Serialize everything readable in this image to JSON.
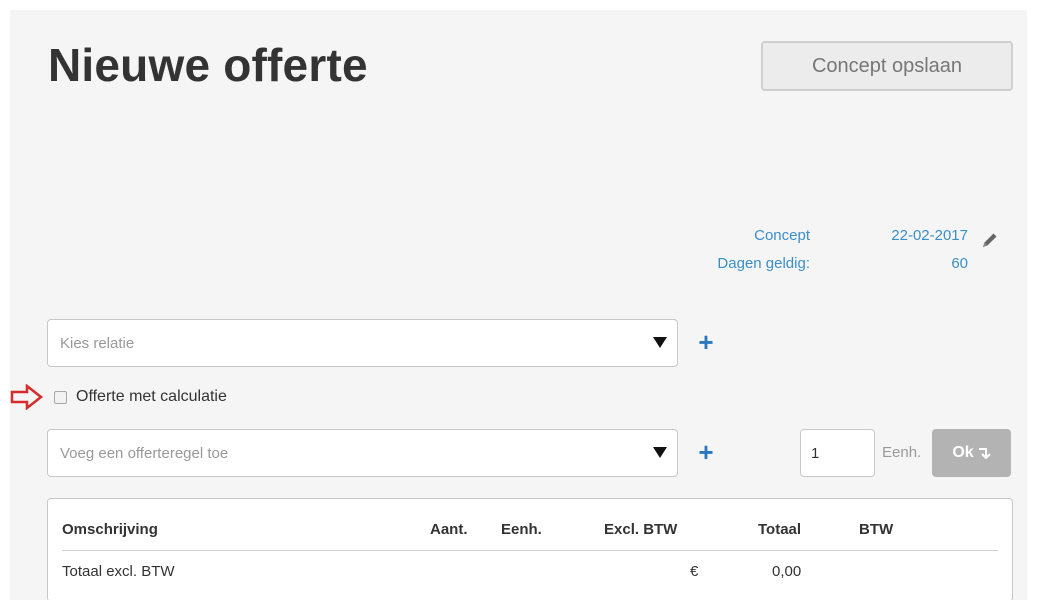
{
  "header": {
    "title": "Nieuwe offerte",
    "save_draft_label": "Concept opslaan"
  },
  "meta": {
    "status_label": "Concept",
    "date_value": "22-02-2017",
    "valid_days_label": "Dagen geldig:",
    "valid_days_value": "60",
    "edit_icon": "pencil-icon"
  },
  "relation_select": {
    "placeholder": "Kies relatie",
    "add_icon": "+"
  },
  "calculation_option": {
    "label": "Offerte met calculatie",
    "checked": false,
    "pointer_icon": "arrow-right-outline-icon",
    "pointer_color": "#d62b2b"
  },
  "line_entry": {
    "placeholder": "Voeg een offerteregel toe",
    "add_icon": "+",
    "quantity": "1",
    "unit_placeholder": "Eenh.",
    "ok_label": "Ok"
  },
  "table": {
    "columns": [
      "Omschrijving",
      "Aant.",
      "Eenh.",
      "Excl. BTW",
      "Totaal",
      "BTW"
    ],
    "summary": {
      "label": "Totaal excl. BTW",
      "currency": "€",
      "amount": "0,00"
    }
  },
  "colors": {
    "accent": "#2a78c2",
    "link": "#3a8fc8",
    "panel_bg": "#f5f5f5",
    "ok_disabled": "#b3b3b3"
  }
}
